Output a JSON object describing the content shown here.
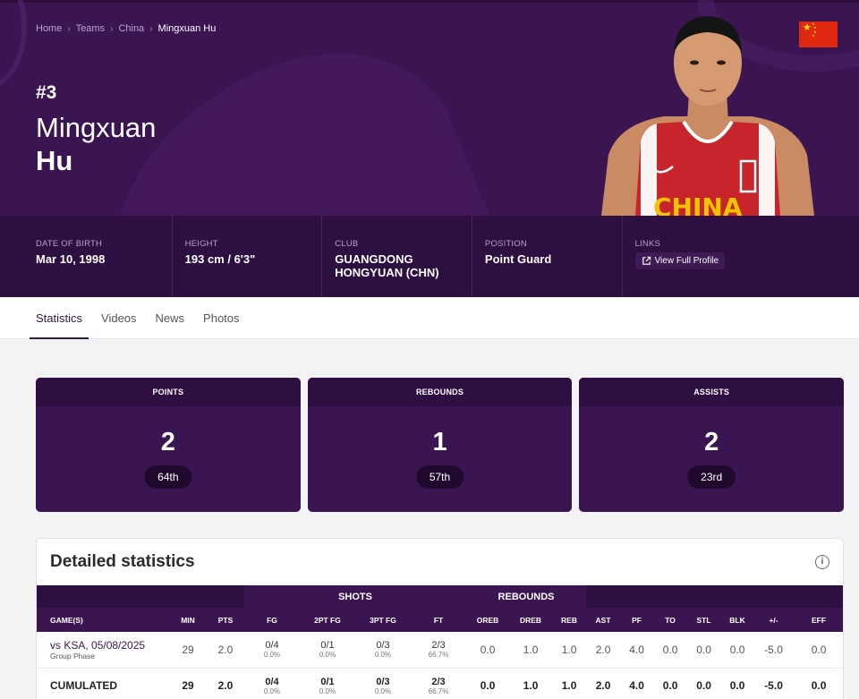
{
  "breadcrumb": [
    "Home",
    "Teams",
    "China",
    "Mingxuan Hu"
  ],
  "player": {
    "number": "#3",
    "first_name": "Mingxuan",
    "last_name": "Hu",
    "jersey_text": "CHINA"
  },
  "info": [
    {
      "label": "DATE OF BIRTH",
      "value": "Mar 10, 1998"
    },
    {
      "label": "HEIGHT",
      "value": "193 cm / 6'3\""
    },
    {
      "label": "CLUB",
      "value": "GUANGDONG HONGYUAN (CHN)"
    },
    {
      "label": "POSITION",
      "value": "Point Guard"
    },
    {
      "label": "LINKS",
      "value": "View Full Profile"
    }
  ],
  "tabs": [
    "Statistics",
    "Videos",
    "News",
    "Photos"
  ],
  "cards": [
    {
      "label": "POINTS",
      "value": "2",
      "rank": "64th"
    },
    {
      "label": "REBOUNDS",
      "value": "1",
      "rank": "57th"
    },
    {
      "label": "ASSISTS",
      "value": "2",
      "rank": "23rd"
    }
  ],
  "detail": {
    "title": "Detailed statistics",
    "group_shots": "SHOTS",
    "group_rebounds": "REBOUNDS",
    "columns": [
      "GAME(S)",
      "MIN",
      "PTS",
      "FG",
      "2PT FG",
      "3PT FG",
      "FT",
      "OREB",
      "DREB",
      "REB",
      "AST",
      "PF",
      "TO",
      "STL",
      "BLK",
      "+/-",
      "EFF"
    ],
    "rows": [
      {
        "game": "vs KSA, 05/08/2025",
        "phase": "Group Phase",
        "min": "29",
        "pts": "2.0",
        "fg": "0/4",
        "fg_pct": "0.0%",
        "fg2": "0/1",
        "fg2_pct": "0.0%",
        "fg3": "0/3",
        "fg3_pct": "0.0%",
        "ft": "2/3",
        "ft_pct": "66.7%",
        "oreb": "0.0",
        "dreb": "1.0",
        "reb": "1.0",
        "ast": "2.0",
        "pf": "4.0",
        "to": "0.0",
        "stl": "0.0",
        "blk": "0.0",
        "pm": "-5.0",
        "eff": "0.0"
      },
      {
        "game": "CUMULATED",
        "phase": "",
        "min": "29",
        "pts": "2.0",
        "fg": "0/4",
        "fg_pct": "0.0%",
        "fg2": "0/1",
        "fg2_pct": "0.0%",
        "fg3": "0/3",
        "fg3_pct": "0.0%",
        "ft": "2/3",
        "ft_pct": "66.7%",
        "oreb": "0.0",
        "dreb": "1.0",
        "reb": "1.0",
        "ast": "2.0",
        "pf": "4.0",
        "to": "0.0",
        "stl": "0.0",
        "blk": "0.0",
        "pm": "-5.0",
        "eff": "0.0"
      }
    ]
  },
  "colors": {
    "purple_dark": "#2d0f42",
    "purple": "#3b1552",
    "flag_red": "#de2910",
    "flag_yellow": "#ffde00"
  }
}
